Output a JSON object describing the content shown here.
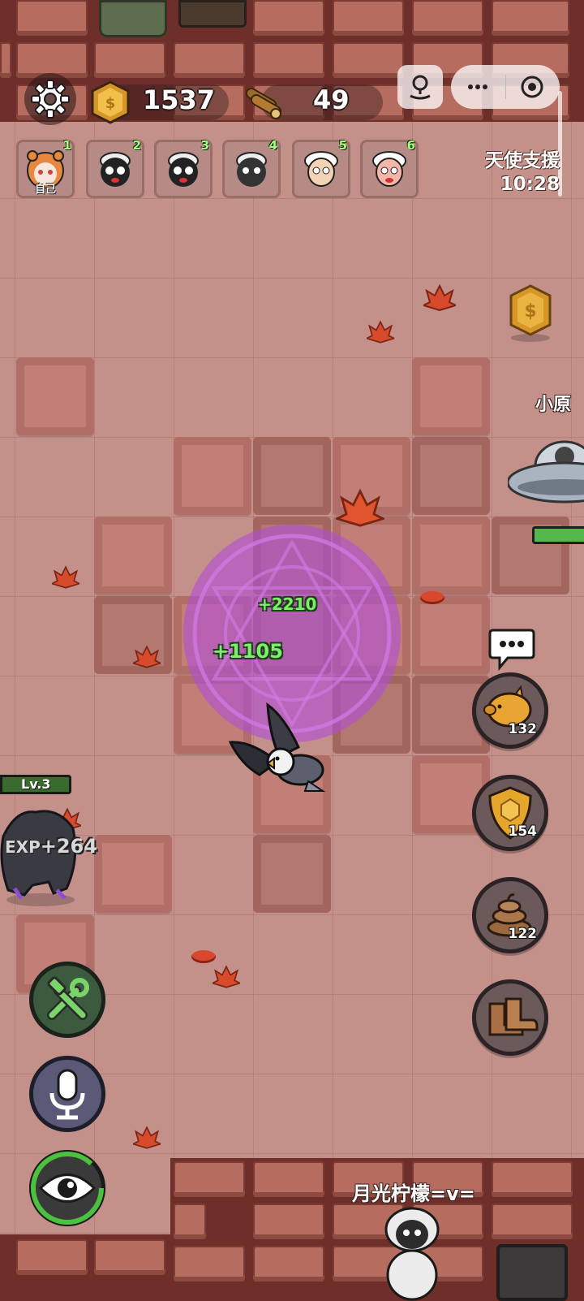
{
  "hud": {
    "coins": "1537",
    "wood": "49"
  },
  "players": [
    {
      "num": "1",
      "tag": "自己",
      "face": "tiger-hood-player-icon"
    },
    {
      "num": "2",
      "face": "black-sheep-icon"
    },
    {
      "num": "3",
      "face": "black-sheep-icon"
    },
    {
      "num": "4",
      "face": "black-sheep-icon"
    },
    {
      "num": "5",
      "face": "white-sheep-icon"
    },
    {
      "num": "6",
      "face": "pink-sheep-icon"
    }
  ],
  "support": {
    "label": "天使支援",
    "timer": "10:28"
  },
  "world": {
    "enemy_name": "小原",
    "player_name": "月光柠檬=v=",
    "float_1": "+2210",
    "float_2": "+1105",
    "level_label": "Lv.3",
    "exp_label": "EXP",
    "exp_gain": "+264"
  },
  "skills": [
    {
      "name": "piggy-bank",
      "count": "132"
    },
    {
      "name": "shield",
      "count": "154"
    },
    {
      "name": "poop",
      "count": "122"
    },
    {
      "name": "boots",
      "count": ""
    }
  ],
  "colors": {
    "floor": "#c3908a",
    "wall": "#6e2f2a",
    "magic_circle": "#b04cd8",
    "gain_text": "#7df06a",
    "gold": "#e6a52b"
  }
}
